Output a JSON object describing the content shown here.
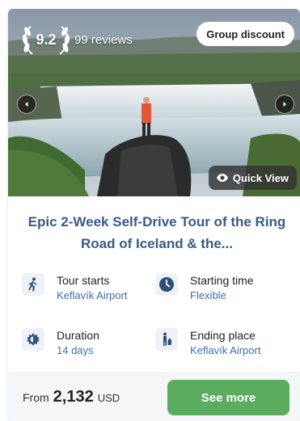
{
  "rating": {
    "score": "9.2",
    "reviews": "99 reviews"
  },
  "badge": {
    "label": "Group discount"
  },
  "quick_view": {
    "label": "Quick View"
  },
  "title": "Epic 2-Week Self-Drive Tour of the Ring Road of Iceland & the...",
  "details": [
    {
      "label": "Tour starts",
      "value": "Keflavík Airport",
      "icon": "hiker-icon"
    },
    {
      "label": "Starting time",
      "value": "Flexible",
      "icon": "clock-icon"
    },
    {
      "label": "Duration",
      "value": "14 days",
      "icon": "sun-moon-icon"
    },
    {
      "label": "Ending place",
      "value": "Keflavík Airport",
      "icon": "person-bag-icon"
    }
  ],
  "price": {
    "prefix": "From",
    "amount": "2,132",
    "currency": "USD"
  },
  "cta": {
    "label": "See more"
  },
  "colors": {
    "accent_text": "#3a5a86",
    "link": "#3a6fb0",
    "button": "#5bac5f"
  }
}
